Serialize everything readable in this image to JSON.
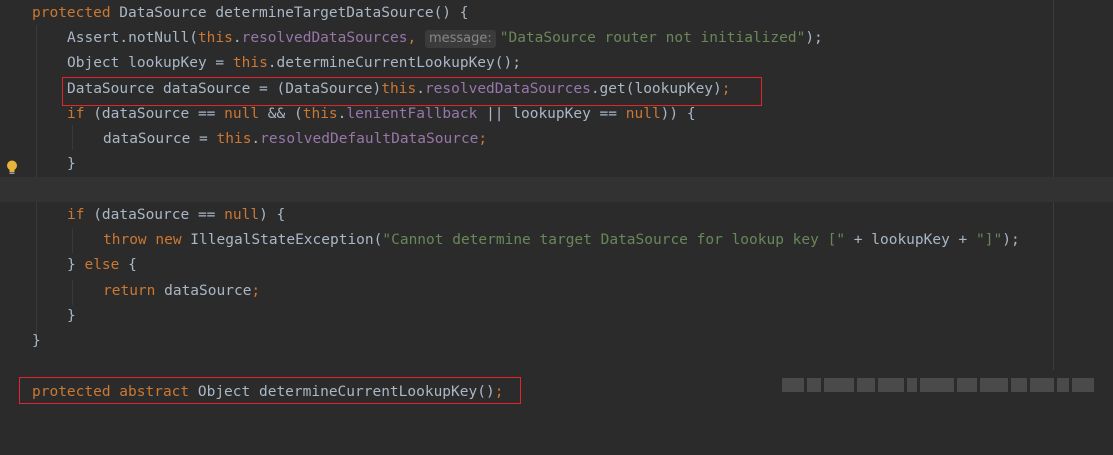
{
  "editor": {
    "param_hint": "message:",
    "lines": [
      {
        "id": "l1"
      },
      {
        "id": "l2"
      }
    ]
  },
  "code": {
    "l1_a": "protected",
    "l1_b": " DataSource determineTargetDataSource() {",
    "l2_a": "Assert.notNull(",
    "l2_b": "this",
    "l2_c": ".",
    "l2_d": "resolvedDataSources",
    "l2_e": ", ",
    "l2_f": "\"DataSource router not initialized\"",
    "l2_g": ");",
    "l3_a": "Object lookupKey = ",
    "l3_b": "this",
    "l3_c": ".determineCurrentLookupKey();",
    "l4_a": "DataSource dataSource = (DataSource)",
    "l4_b": "this",
    "l4_c": ".",
    "l4_d": "resolvedDataSources",
    "l4_e": ".get(lookupKey)",
    "l4_f": ";",
    "l5_a": "if",
    "l5_b": " (dataSource == ",
    "l5_c": "null",
    "l5_d": " && (",
    "l5_e": "this",
    "l5_f": ".",
    "l5_g": "lenientFallback",
    "l5_h": " || lookupKey == ",
    "l5_i": "null",
    "l5_j": ")) {",
    "l6_a": "dataSource = ",
    "l6_b": "this",
    "l6_c": ".",
    "l6_d": "resolvedDefaultDataSource",
    "l6_e": ";",
    "l7_a": "}",
    "l9_a": "if",
    "l9_b": " (dataSource == ",
    "l9_c": "null",
    "l9_d": ") {",
    "l10_a": "throw new",
    "l10_b": " IllegalStateException(",
    "l10_c": "\"Cannot determine target DataSource for lookup key [\"",
    "l10_d": " + lookupKey + ",
    "l10_e": "\"]\"",
    "l10_f": ");",
    "l11_a": "} ",
    "l11_b": "else",
    "l11_c": " {",
    "l12_a": "return",
    "l12_b": " dataSource",
    "l12_c": ";",
    "l13_a": "}",
    "l14_a": "}",
    "l16_a": "protected abstract",
    "l16_b": " Object determineCurrentLookupKey()",
    "l16_c": ";"
  },
  "colors": {
    "background": "#2b2b2b",
    "keyword": "#cc7832",
    "string": "#6a8759",
    "field": "#9876aa",
    "text": "#a9b7c6",
    "highlight_box": "#e0262a"
  },
  "icons": {
    "gutter": "lightbulb-icon"
  }
}
